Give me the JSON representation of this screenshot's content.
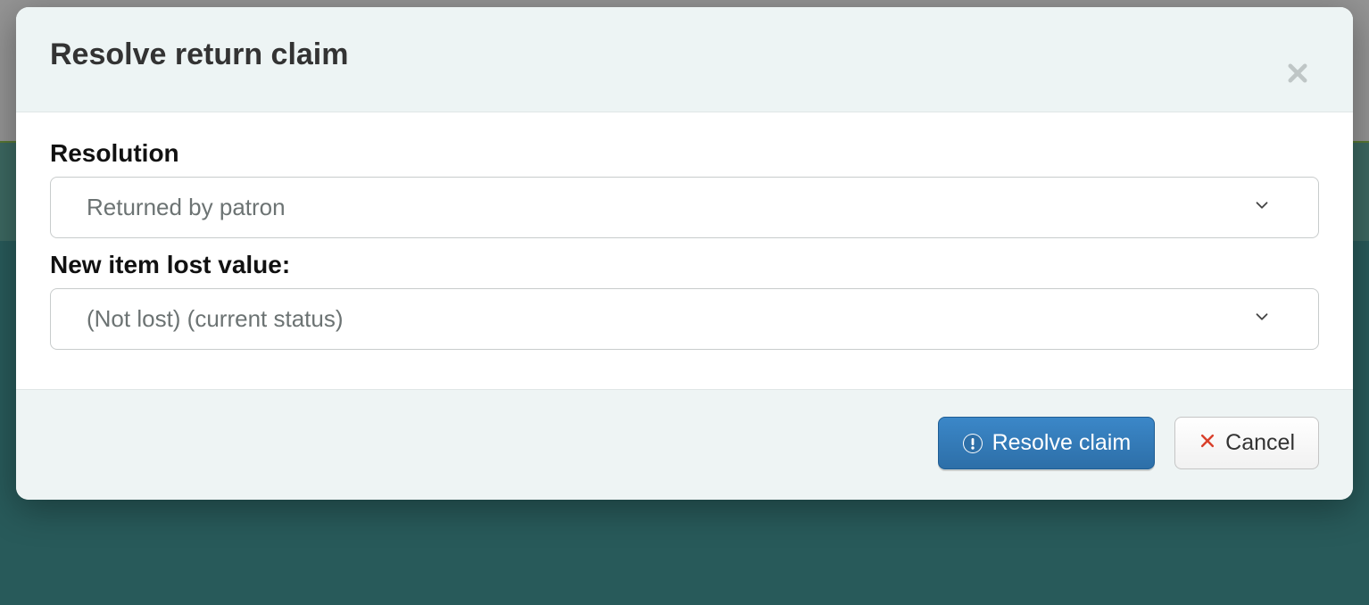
{
  "modal": {
    "title": "Resolve return claim",
    "form": {
      "resolution_label": "Resolution",
      "resolution_selected": "Returned by patron",
      "lost_value_label": "New item lost value:",
      "lost_value_selected": "(Not lost) (current status)"
    },
    "footer": {
      "resolve_label": "Resolve claim",
      "cancel_label": "Cancel"
    }
  }
}
